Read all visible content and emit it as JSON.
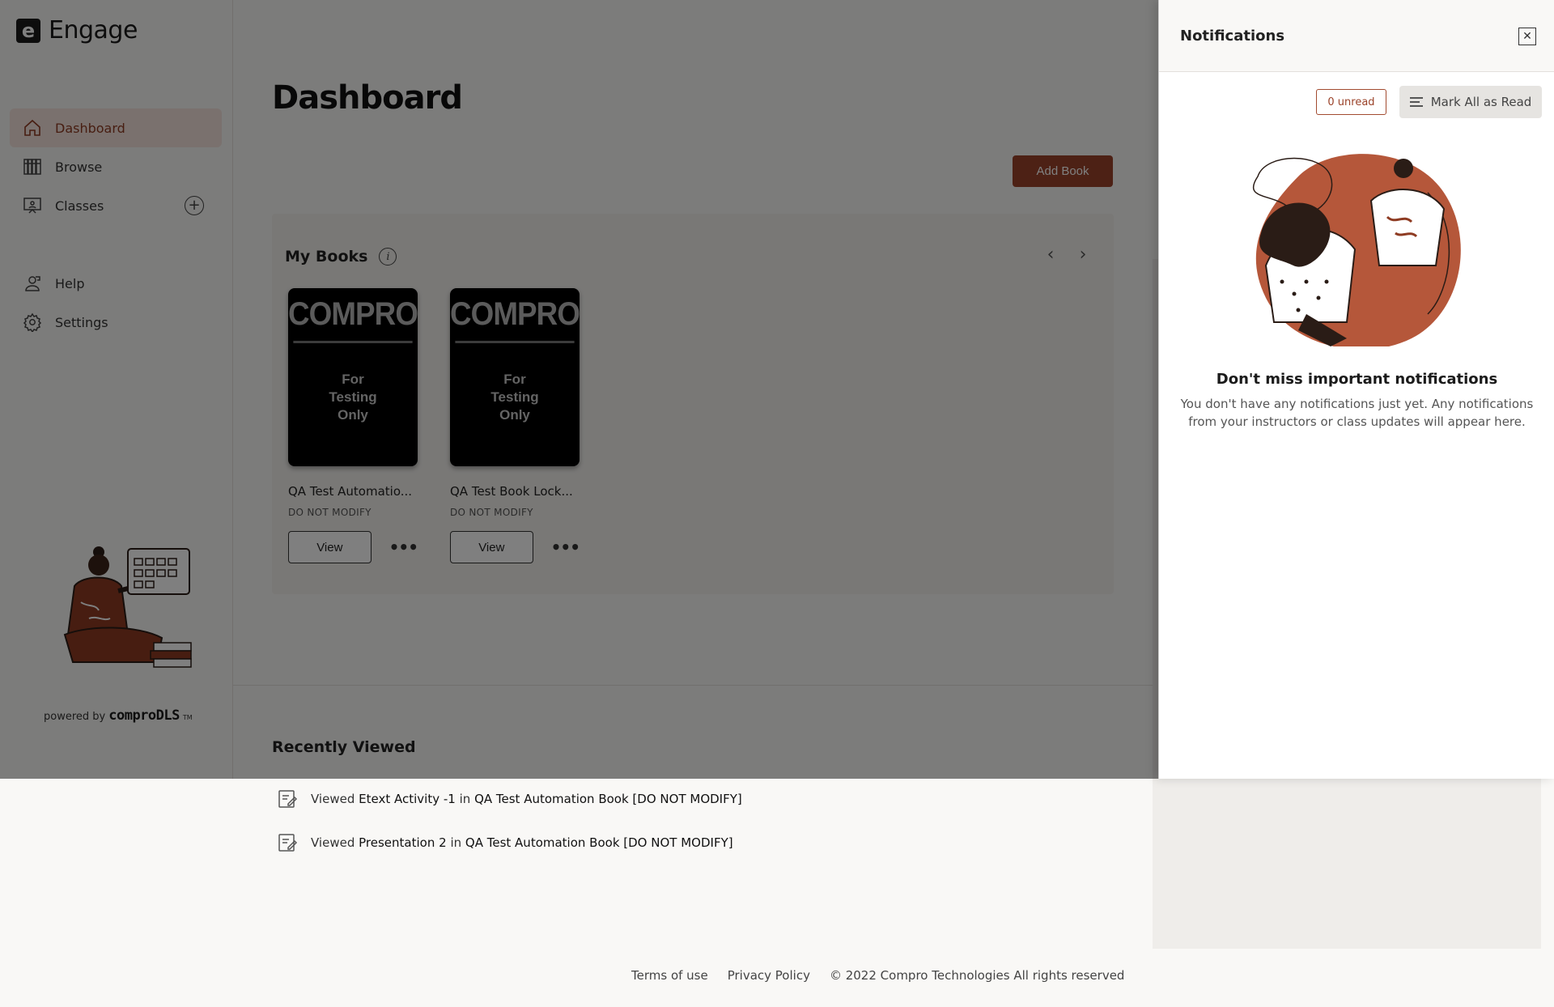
{
  "app": {
    "name": "Engage",
    "logo_letter": "e"
  },
  "sidebar": {
    "items": [
      {
        "label": "Dashboard",
        "icon": "home-icon",
        "active": true
      },
      {
        "label": "Browse",
        "icon": "library-icon"
      },
      {
        "label": "Classes",
        "icon": "classroom-icon"
      },
      {
        "label": "Help",
        "icon": "help-person-icon"
      },
      {
        "label": "Settings",
        "icon": "gear-icon"
      }
    ],
    "powered_prefix": "powered by",
    "powered_brand": "comproDLS",
    "powered_tm": "TM"
  },
  "main": {
    "title": "Dashboard",
    "add_book_label": "Add Book",
    "my_books_title": "My Books",
    "books": [
      {
        "cover_brand": "COMPRO",
        "cover_text": "For\nTesting\nOnly",
        "title": "QA Test Automatio...",
        "meta": "DO NOT MODIFY",
        "view_label": "View"
      },
      {
        "cover_brand": "COMPRO",
        "cover_text": "For\nTesting\nOnly",
        "title": "QA Test Book Lock...",
        "meta": "DO NOT MODIFY",
        "view_label": "View"
      }
    ],
    "recent_title": "Recently Viewed",
    "recent": [
      {
        "verb": "Viewed",
        "item": "Etext Activity -1",
        "in": "in",
        "book": "QA Test Automation Book [DO NOT MODIFY]"
      },
      {
        "verb": "Viewed",
        "item": "Presentation 2",
        "in": "in",
        "book": "QA Test Automation Book [DO NOT MODIFY]"
      }
    ]
  },
  "footer": {
    "terms": "Terms of use",
    "privacy": "Privacy Policy",
    "copyright": "© 2022 Compro Technologies All rights reserved"
  },
  "notifications": {
    "title": "Notifications",
    "unread_label": "0 unread",
    "mark_all_label": "Mark All as Read",
    "empty_title": "Don't miss important notifications",
    "empty_text": "You don't have any notifications just yet. Any notifications from your instructors or class updates will appear here."
  },
  "colors": {
    "accent": "#9b432a",
    "overlay": "rgba(0,0,0,0.5)"
  }
}
